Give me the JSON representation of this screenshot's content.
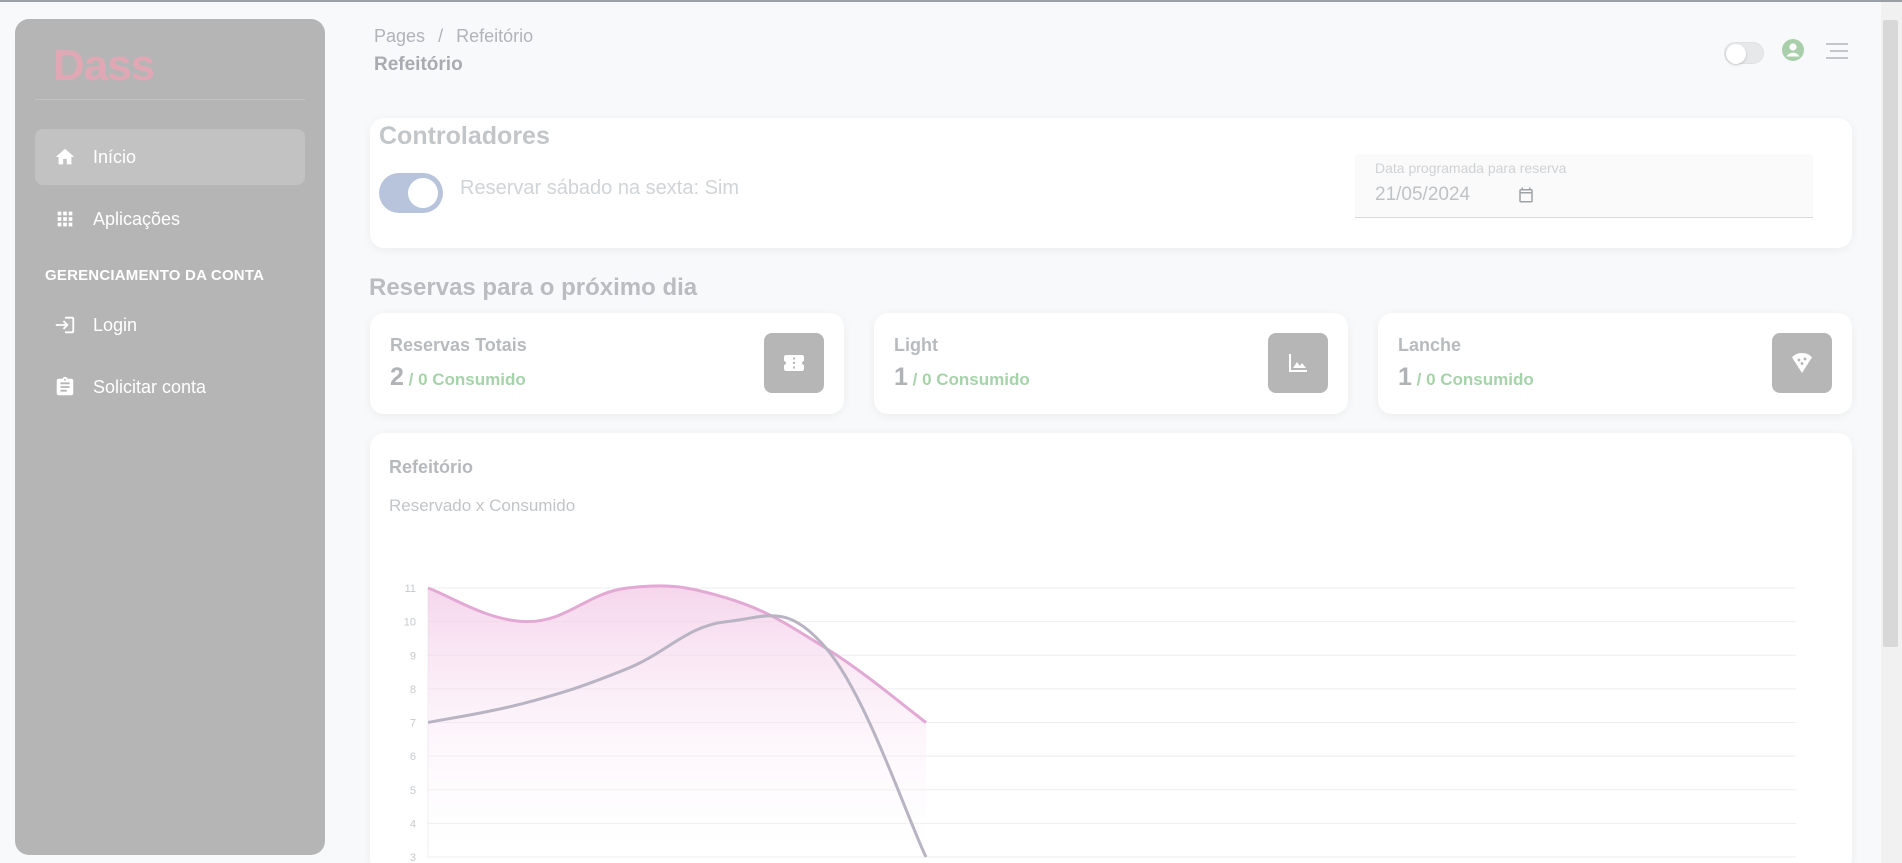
{
  "sidebar": {
    "logo": "Dass",
    "items": [
      {
        "label": "Início",
        "icon": "home-icon"
      },
      {
        "label": "Aplicações",
        "icon": "apps-grid-icon"
      }
    ],
    "account_heading": "GERENCIAMENTO DA CONTA",
    "account_items": [
      {
        "label": "Login",
        "icon": "login-icon"
      },
      {
        "label": "Solicitar conta",
        "icon": "clipboard-icon"
      }
    ]
  },
  "header": {
    "breadcrumb_root": "Pages",
    "breadcrumb_sep": "/",
    "breadcrumb_current": "Refeitório",
    "title": "Refeitório"
  },
  "controls": {
    "title": "Controladores",
    "toggle_label": "Reservar sábado na sexta: Sim",
    "toggle_on": true,
    "date_label": "Data programada para reserva",
    "date_value": "21/05/2024"
  },
  "reservations": {
    "title": "Reservas para o próximo dia",
    "cards": [
      {
        "label": "Reservas Totais",
        "value": "2",
        "sub": " / 0 Consumido",
        "icon": "ticket-icon"
      },
      {
        "label": "Light",
        "value": "1",
        "sub": " / 0 Consumido",
        "icon": "landscape-icon"
      },
      {
        "label": "Lanche",
        "value": "1",
        "sub": " / 0 Consumido",
        "icon": "pizza-icon"
      }
    ]
  },
  "chart": {
    "title": "Refeitório",
    "subtitle": "Reservado x Consumido"
  },
  "colors": {
    "series_reserved": "#e2a9d4",
    "series_consumed": "#b9b4c4"
  },
  "chart_data": {
    "type": "line",
    "x": [
      0,
      1,
      2,
      3,
      4,
      5
    ],
    "series": [
      {
        "values": [
          11,
          10,
          11,
          10.7,
          9.2,
          7
        ]
      },
      {
        "values": [
          7,
          7.6,
          8.6,
          10,
          9.2,
          3
        ]
      }
    ],
    "yticks": [
      "11",
      "10",
      "9",
      "8",
      "7",
      "6",
      "5",
      "4",
      "3"
    ],
    "ylim": [
      3,
      11
    ],
    "grid": true
  }
}
